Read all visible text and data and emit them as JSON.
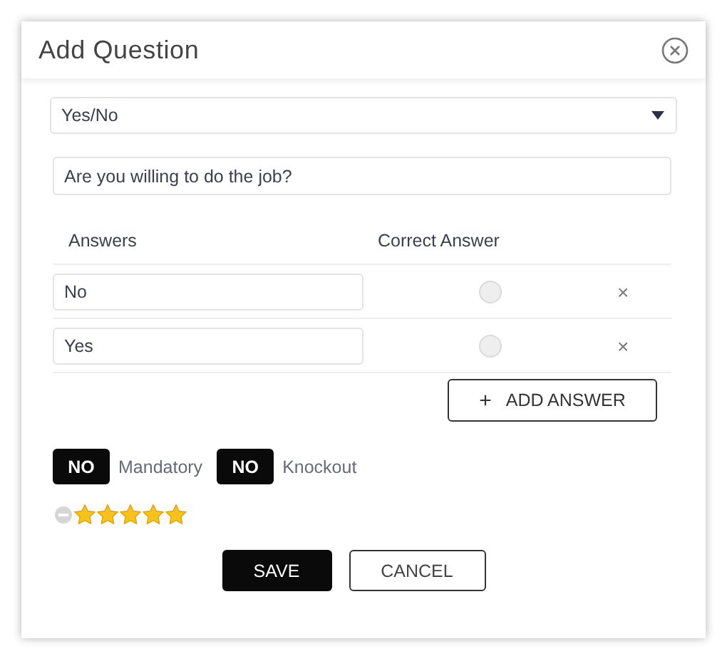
{
  "dialog": {
    "title": "Add Question"
  },
  "question_type": {
    "value": "Yes/No"
  },
  "question": {
    "value": "Are you willing to do the job?"
  },
  "answers_table": {
    "columns": [
      "Answers",
      "Correct Answer"
    ],
    "rows": [
      {
        "answer": "No",
        "correct": false,
        "remove": "×"
      },
      {
        "answer": "Yes",
        "correct": false,
        "remove": "×"
      }
    ]
  },
  "add_answer_button": {
    "icon": "+",
    "label": "ADD ANSWER"
  },
  "toggles": [
    {
      "state_text": "NO",
      "on": false,
      "label": "Mandatory"
    },
    {
      "state_text": "NO",
      "on": false,
      "label": "Knockout"
    }
  ],
  "rating": {
    "stars": 5
  },
  "buttons": [
    {
      "label": "SAVE",
      "kind": "primary"
    },
    {
      "label": "CANCEL",
      "kind": "secondary"
    }
  ]
}
